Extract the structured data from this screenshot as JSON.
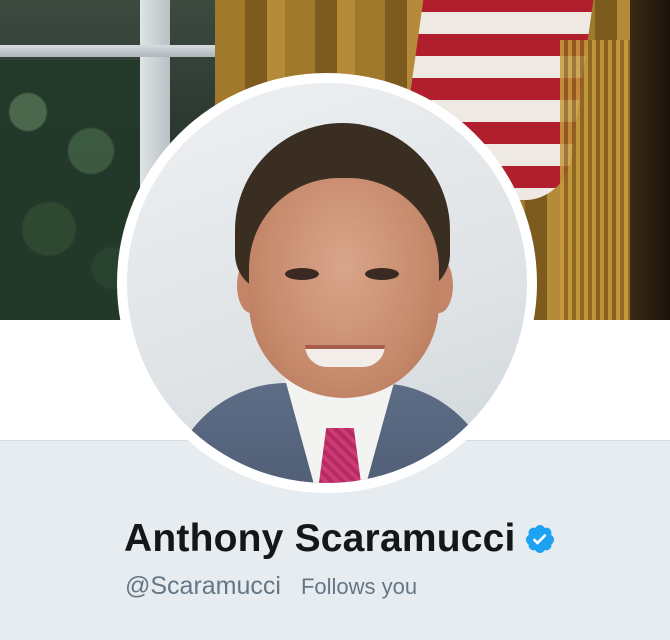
{
  "profile": {
    "name": "Anthony Scaramucci",
    "handle": "@Scaramucci",
    "follows_label": "Follows you",
    "verified": true
  },
  "icons": {
    "verified": "verified-badge-icon"
  },
  "colors": {
    "verified_blue": "#1da1f2",
    "name_text": "#14171a",
    "secondary_text": "#657786",
    "page_background": "#e6ecf0"
  }
}
